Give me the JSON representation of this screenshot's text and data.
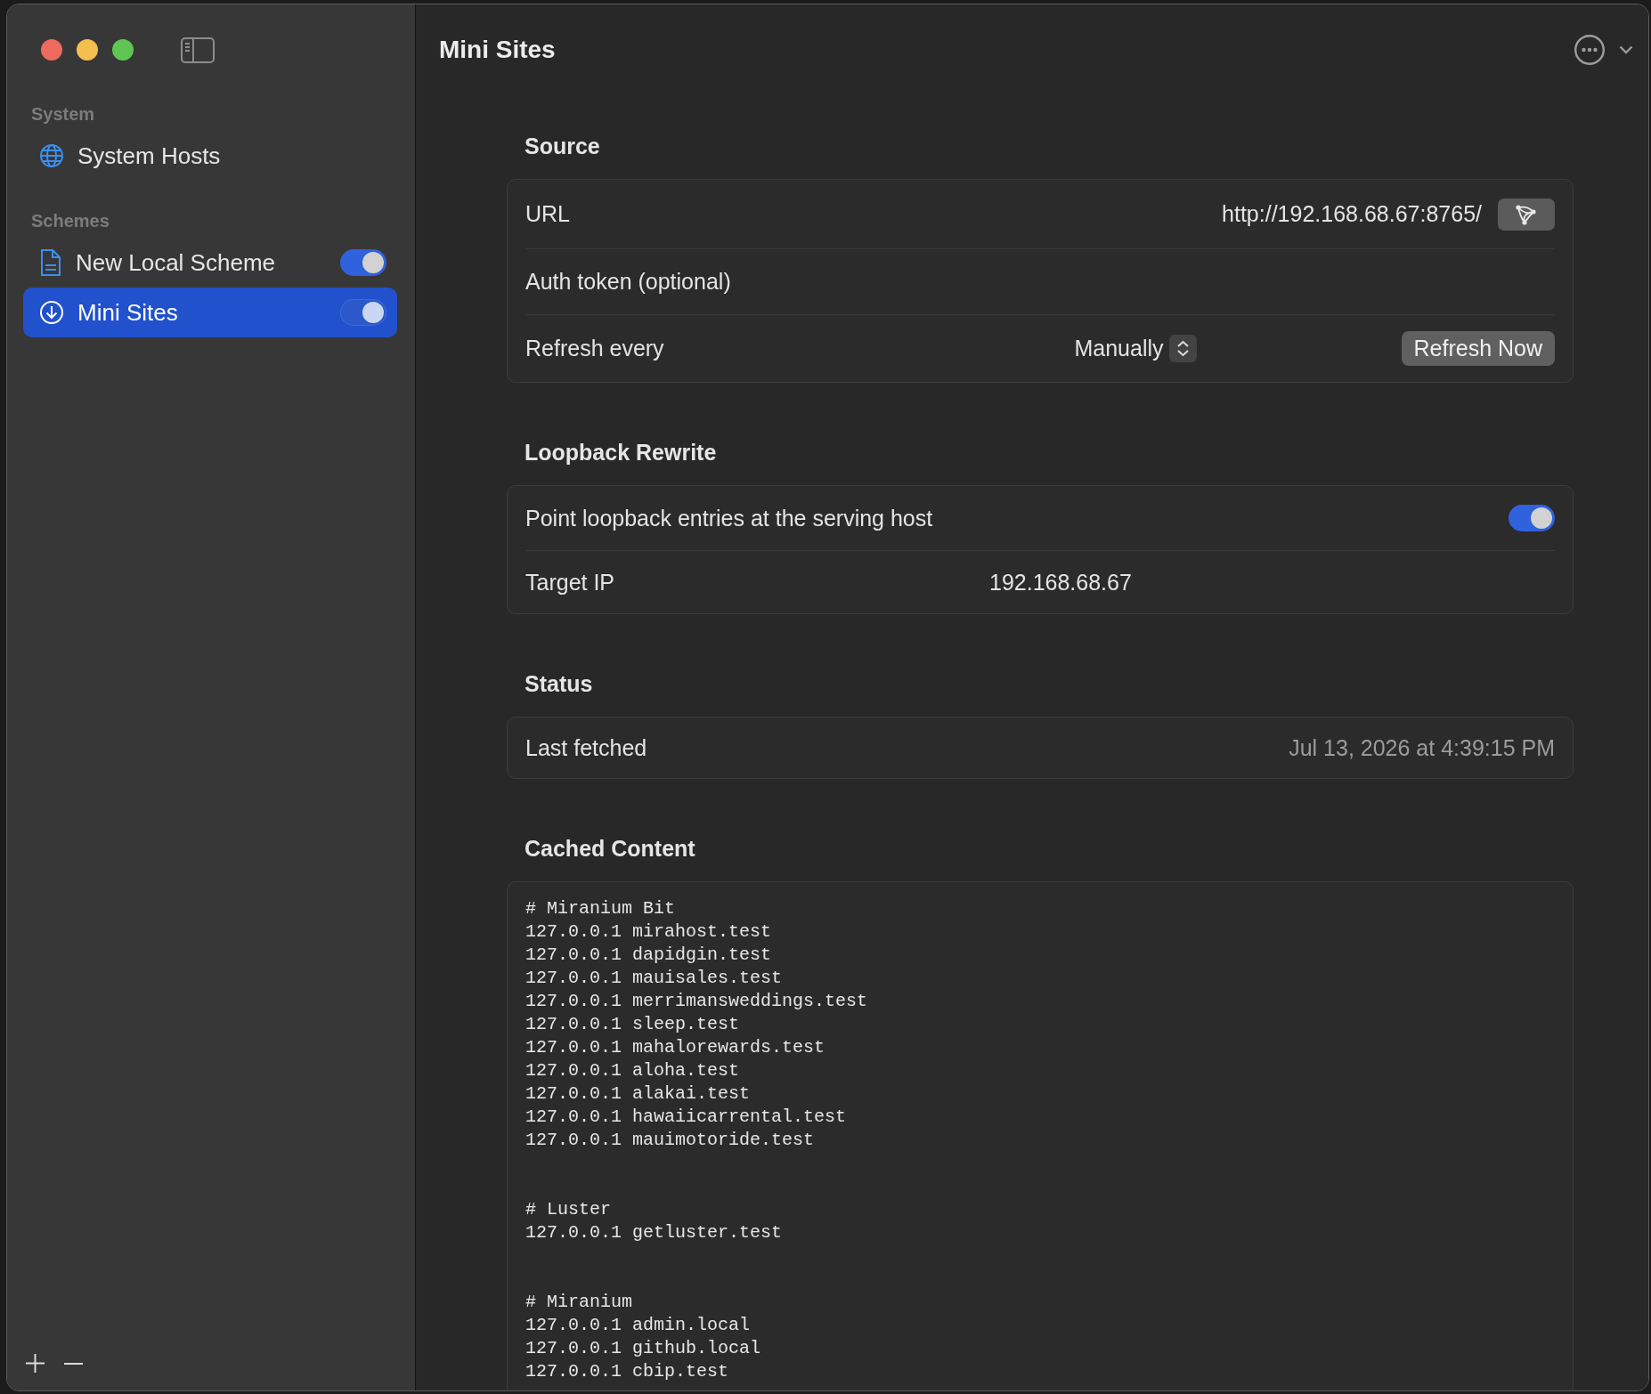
{
  "window": {
    "title": "Mini Sites"
  },
  "sidebar": {
    "sections": [
      {
        "header": "System",
        "items": [
          {
            "kind": "system",
            "label": "System Hosts",
            "selected": false
          }
        ]
      },
      {
        "header": "Schemes",
        "items": [
          {
            "kind": "local",
            "label": "New Local Scheme",
            "selected": false,
            "on": true
          },
          {
            "kind": "remote",
            "label": "Mini Sites",
            "selected": true,
            "on": true
          }
        ]
      }
    ]
  },
  "source": {
    "header": "Source",
    "url": {
      "label": "URL",
      "value": "http://192.168.68.67:8765/"
    },
    "auth_token": {
      "label": "Auth token (optional)"
    },
    "refresh": {
      "label": "Refresh every",
      "value": "Manually",
      "button": "Refresh Now"
    }
  },
  "loopback_rewrite": {
    "header": "Loopback Rewrite",
    "point_loopback": {
      "label": "Point loopback entries at the serving host",
      "on": true
    },
    "target_ip": {
      "label": "Target IP",
      "value": "192.168.68.67"
    }
  },
  "status": {
    "header": "Status",
    "last_fetched": {
      "label": "Last fetched",
      "value": "Jul 13, 2026 at 4:39:15 PM"
    }
  },
  "cached_content": {
    "header": "Cached Content",
    "blocks": [
      {
        "lines": [
          "# Miranium Bit",
          "127.0.0.1 mirahost.test",
          "127.0.0.1 dapidgin.test",
          "127.0.0.1 mauisales.test",
          "127.0.0.1 merrimansweddings.test",
          "127.0.0.1 sleep.test",
          "127.0.0.1 mahalorewards.test",
          "127.0.0.1 aloha.test",
          "127.0.0.1 alakai.test",
          "127.0.0.1 hawaiicarrental.test",
          "127.0.0.1 mauimotoride.test"
        ]
      },
      {
        "lines": [
          "# Luster",
          "127.0.0.1 getluster.test"
        ]
      },
      {
        "lines": [
          "# Miranium",
          "127.0.0.1 admin.local",
          "127.0.0.1 github.local",
          "127.0.0.1 cbip.test"
        ]
      }
    ]
  }
}
